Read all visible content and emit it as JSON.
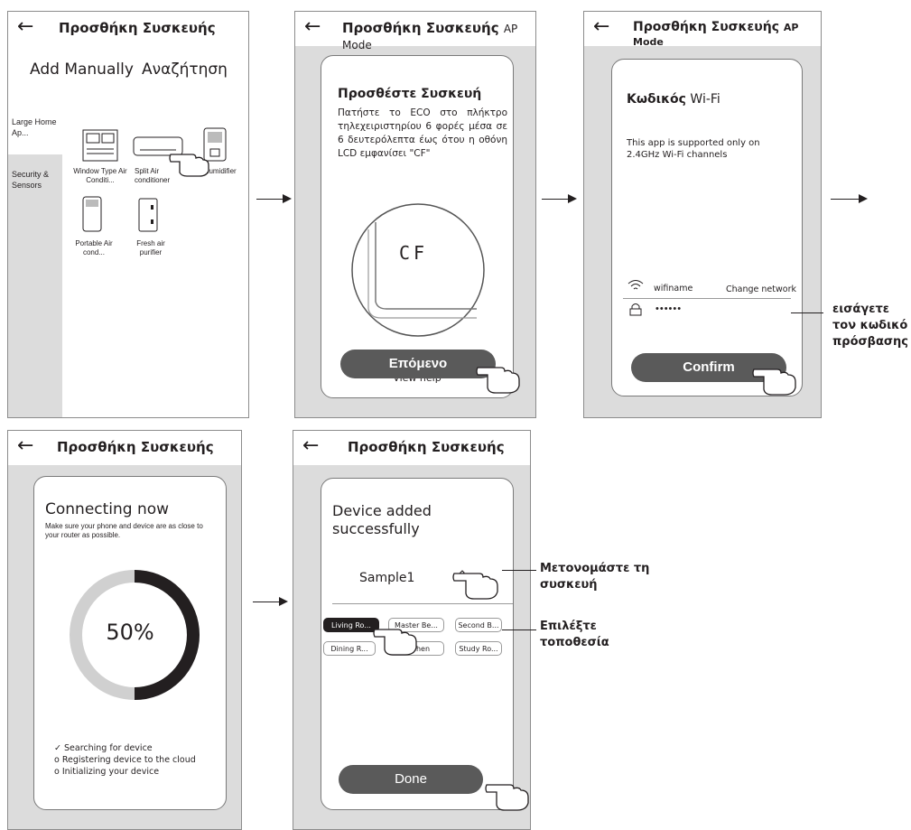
{
  "colors": {
    "button": "#5a5a5a",
    "panel": "#dcdcdc",
    "progress_dark": "#231f20",
    "progress_light": "#d0d0d0"
  },
  "screen1": {
    "title": "Προσθήκη Συσκευής",
    "tab_manual": "Add Manually",
    "tab_search": "Αναζήτηση",
    "categories": [
      "Large Home Ap...",
      "Security & Sensors"
    ],
    "devices": [
      "Window Type Air Conditi...",
      "Split Air conditioner",
      "humidifier",
      "Portable Air cond...",
      "Fresh air purifier"
    ]
  },
  "screen2": {
    "title": "Προσθήκη Συσκευής",
    "mode": "AP Mode",
    "heading": "Προσθέστε Συσκευή",
    "instruction": "Πατήστε το ECO στο πλήκτρο τηλεχειριστηρίου 6 φορές μέσα σε 6 δευτερόλεπτα έως ότου η οθόνη LCD εμφανίσει \"CF\"",
    "display": "CF",
    "help": "View help",
    "next": "Επόμενο"
  },
  "screen3": {
    "title": "Προσθήκη Συσκευής",
    "mode": "AP Mode",
    "heading_bold": "Κωδικός",
    "heading_rest": "Wi-Fi",
    "info": "This app is supported only on 2.4GHz Wi-Fi channels",
    "wifi_name": "wifiname",
    "change_network": "Change network",
    "password": "••••••",
    "confirm": "Confirm",
    "note_line1": "εισάγετε",
    "note_line2": "τον κωδικό",
    "note_line3": "πρόσβασης"
  },
  "screen4": {
    "title": "Προσθήκη Συσκευής",
    "connecting": "Connecting now",
    "sub": "Make sure your phone and device are as close to your router as possible.",
    "percent": "50%",
    "progress": 0.5,
    "step1": "Searching for device",
    "step2": "Registering device to the cloud",
    "step3": "Initializing your device",
    "step1_mark": "✓",
    "step_mark": "o"
  },
  "screen5": {
    "title": "Προσθήκη Συσκευής",
    "added": "Device added successfully",
    "device_name": "Sample1",
    "rooms": [
      "Living Ro...",
      "Master Be...",
      "Second B...",
      "Dining R...",
      "Kitchen",
      "Study Ro..."
    ],
    "done": "Done",
    "note_rename_1": "Μετονομάστε τη",
    "note_rename_2": "συσκευή",
    "note_location_1": "Επιλέξτε",
    "note_location_2": "τοποθεσία"
  }
}
